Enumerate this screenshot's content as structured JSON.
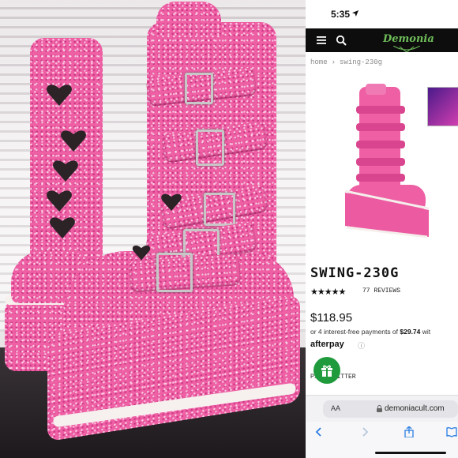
{
  "status": {
    "time": "5:35"
  },
  "site": {
    "logo": "Demonia"
  },
  "breadcrumb": {
    "home": "home",
    "separator": "›",
    "current": "swing-230g"
  },
  "product": {
    "title": "SWING-230G",
    "stars": "★★★★★",
    "reviews": "77 REVIEWS",
    "price": "$118.95",
    "installments_prefix": "or 4 interest-free payments of ",
    "installment_amount": "$29.74",
    "installments_suffix": " wit",
    "afterpay": "afterpay",
    "afterpay_info": "ⓘ",
    "color_label": "PINK GLITTER"
  },
  "browser": {
    "aa": "AA",
    "url": "demoniacult.com"
  },
  "colors": {
    "accent_green": "#1f9a3c",
    "glitter_pink": "#ee5fa4",
    "logo_green": "#6fbf5a"
  }
}
